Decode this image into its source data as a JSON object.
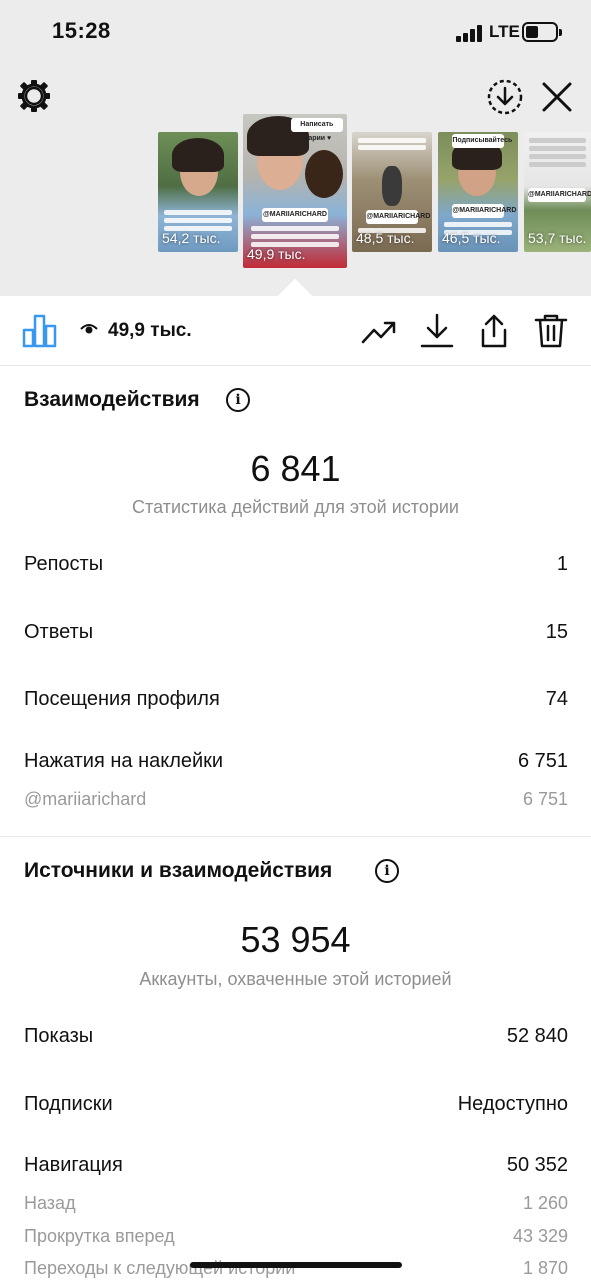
{
  "status_bar": {
    "time": "15:28",
    "network": "LTE"
  },
  "thumbnails": [
    {
      "views": "54,2 тыс.",
      "selected": false
    },
    {
      "views": "49,9 тыс.",
      "handle": "@MARIIARICHARD",
      "selected": true
    },
    {
      "views": "48,5 тыс.",
      "handle": "@MARIIARICHARD",
      "selected": false
    },
    {
      "views": "46,5 тыс.",
      "handle": "@MARIIARICHARD",
      "selected": false
    },
    {
      "views": "53,7 тыс.",
      "handle": "@MARIIARICHARD",
      "selected": false
    }
  ],
  "toolbar": {
    "views": "49,9 тыс."
  },
  "interactions": {
    "title": "Взаимодействия",
    "total": "6 841",
    "caption": "Статистика действий для этой истории",
    "rows": [
      {
        "label": "Репосты",
        "value": "1"
      },
      {
        "label": "Ответы",
        "value": "15"
      },
      {
        "label": "Посещения профиля",
        "value": "74"
      },
      {
        "label": "Нажатия на наклейки",
        "value": "6 751"
      }
    ],
    "sub_rows": [
      {
        "label": "@mariiarichard",
        "value": "6 751"
      }
    ]
  },
  "reach": {
    "title": "Источники и взаимодействия",
    "total": "53 954",
    "caption": "Аккаунты, охваченные этой историей",
    "rows": [
      {
        "label": "Показы",
        "value": "52 840"
      },
      {
        "label": "Подписки",
        "value": "Недоступно"
      },
      {
        "label": "Навигация",
        "value": "50 352"
      }
    ],
    "sub_rows": [
      {
        "label": "Назад",
        "value": "1 260"
      },
      {
        "label": "Прокрутка вперед",
        "value": "43 329"
      },
      {
        "label": "Переходы к следующей истории",
        "value": "1 870"
      }
    ]
  },
  "colors": {
    "accent": "#3897f0",
    "background_top": "#ececec",
    "muted": "#8e8e8e"
  },
  "icons": [
    "gear-icon",
    "download-circle-icon",
    "close-icon",
    "bar-chart-icon",
    "eye-icon",
    "trend-icon",
    "download-icon",
    "share-icon",
    "trash-icon",
    "info-icon"
  ]
}
